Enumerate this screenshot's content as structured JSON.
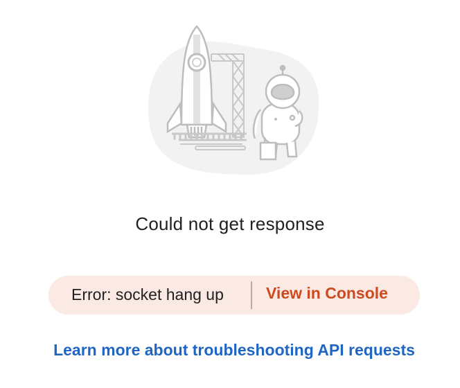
{
  "empty_state": {
    "title": "Could not get response"
  },
  "error": {
    "message": "Error: socket hang up",
    "console_link": "View in Console"
  },
  "help": {
    "link_text": "Learn more about troubleshooting API requests"
  },
  "colors": {
    "pill_background": "#fbe9e4",
    "console_link": "#cc4a1f",
    "help_link": "#1f66c4",
    "illustration_blob": "#f2f2f2",
    "illustration_line": "#c8c8c8"
  },
  "icons": {
    "illustration": "rocket-launch-astronaut-illustration"
  }
}
